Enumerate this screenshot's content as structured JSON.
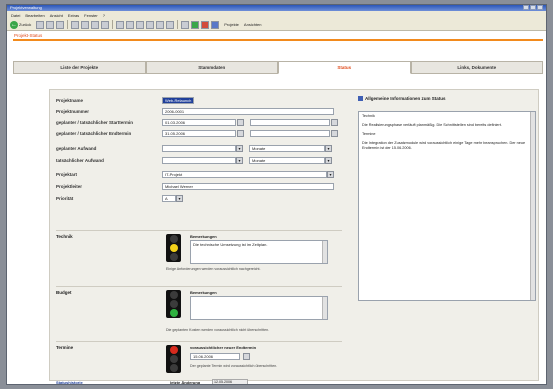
{
  "window": {
    "title": "Projektverwaltung"
  },
  "menu": [
    "Datei",
    "Bearbeiten",
    "Ansicht",
    "Extras",
    "Fenster",
    "?"
  ],
  "toolbar": {
    "back_label": "Zurück",
    "tags": [
      "Projekte",
      "Ansichten"
    ]
  },
  "page_link": "Projekt-Status",
  "tabs": [
    {
      "label": "Liste der Projekte",
      "active": false
    },
    {
      "label": "Stammdaten",
      "active": false
    },
    {
      "label": "Status",
      "active": true
    },
    {
      "label": "Links, Dokumente",
      "active": false
    }
  ],
  "form": {
    "projektname": {
      "label": "Projektname",
      "value": "Web-Relaunch"
    },
    "projektnummer": {
      "label": "Projektnummer",
      "value": "2006-0001"
    },
    "start": {
      "label": "geplanter / tatsächlicher Starttermin",
      "planned": "01.03.2006",
      "actual": ""
    },
    "ende": {
      "label": "geplanter / tatsächlicher Endtermin",
      "planned": "31.05.2006",
      "actual": ""
    },
    "aufwand_geplant": {
      "label": "geplanter Aufwand",
      "value": "",
      "unit": "Monate"
    },
    "aufwand_tatsaechlich": {
      "label": "tatsächlicher Aufwand",
      "value": "",
      "unit": "Monate"
    },
    "projektart": {
      "label": "Projektart",
      "value": "IT-Projekt"
    },
    "projektleiter": {
      "label": "Projektleiter",
      "value": "Michael Werner"
    },
    "prioritaet": {
      "label": "Priorität",
      "value": "A"
    }
  },
  "blocks": {
    "technik": {
      "title": "Technik",
      "remarks_label": "Bemerkungen",
      "remarks": "Die technische Umsetzung ist im Zeitplan.",
      "hint": "Einige Anforderungen werden voraussichtlich nachgereicht."
    },
    "budget": {
      "title": "Budget",
      "remarks_label": "Bemerkungen",
      "remarks": "",
      "hint": "Die geplanten Kosten werden voraussichtlich nicht überschritten."
    },
    "termine": {
      "title": "Termine",
      "due_label": "voraussichtlicher neuer Endtermin",
      "due_value": "15.06.2006",
      "hint": "Der geplante Termin wird voraussichtlich überschritten."
    }
  },
  "info": {
    "title": "Allgemeine Informationen zum Status",
    "paragraphs": [
      "Technik",
      "Die Realisierungsphase verläuft planmäßig. Die Schnittstellen sind bereits definiert.",
      "Termine",
      "Die Integration der Zusatzmodule wird voraussichtlich einige Tage mehr beanspruchen. Der neue Endtermin ist der 15.06.2006."
    ]
  },
  "footer": {
    "link": "Statushistorie",
    "last_update_label": "letzte Änderung",
    "last_update_value": "12.05.2006"
  },
  "colors": {
    "accent": "#f28a1c",
    "link": "#e04a1a",
    "signal_red": "#d72a1d",
    "signal_yellow": "#f3d11a",
    "signal_green": "#2fb13f",
    "signal_off": "#3b3b3b"
  }
}
